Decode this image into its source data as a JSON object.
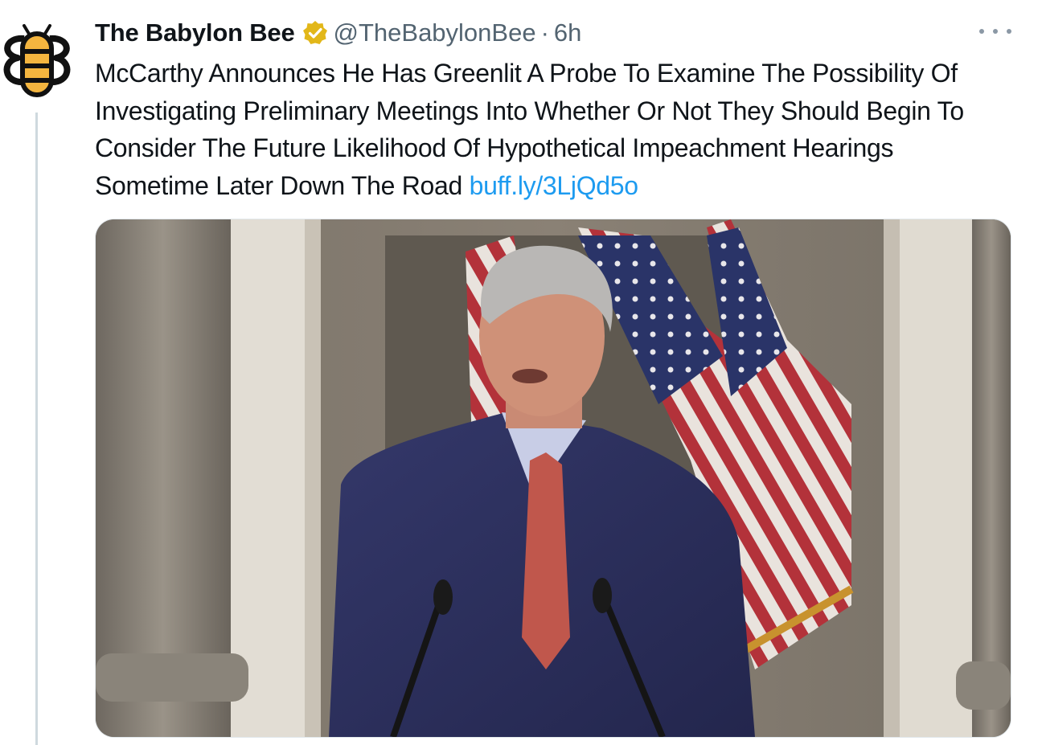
{
  "tweet": {
    "display_name": "The Babylon Bee",
    "handle": "@TheBabylonBee",
    "separator": "·",
    "time": "6h",
    "text": "McCarthy Announces He Has Greenlit A Probe To Examine The Possibility Of Investigating Preliminary Meetings Into Whether Or Not They Should Begin To Consider The Future Likelihood Of Hypothetical Impeachment Hearings Sometime Later Down The Road",
    "link": "buff.ly/3LjQd5o"
  },
  "icons": {
    "avatar": "babylon-bee-logo",
    "verified": "verified-badge-icon",
    "more": "more-options-icon"
  },
  "colors": {
    "text": "#0f1419",
    "secondary": "#536471",
    "link": "#1d9bf0",
    "verified_gold": "#e2b719",
    "thread_line": "#cfd9de"
  }
}
